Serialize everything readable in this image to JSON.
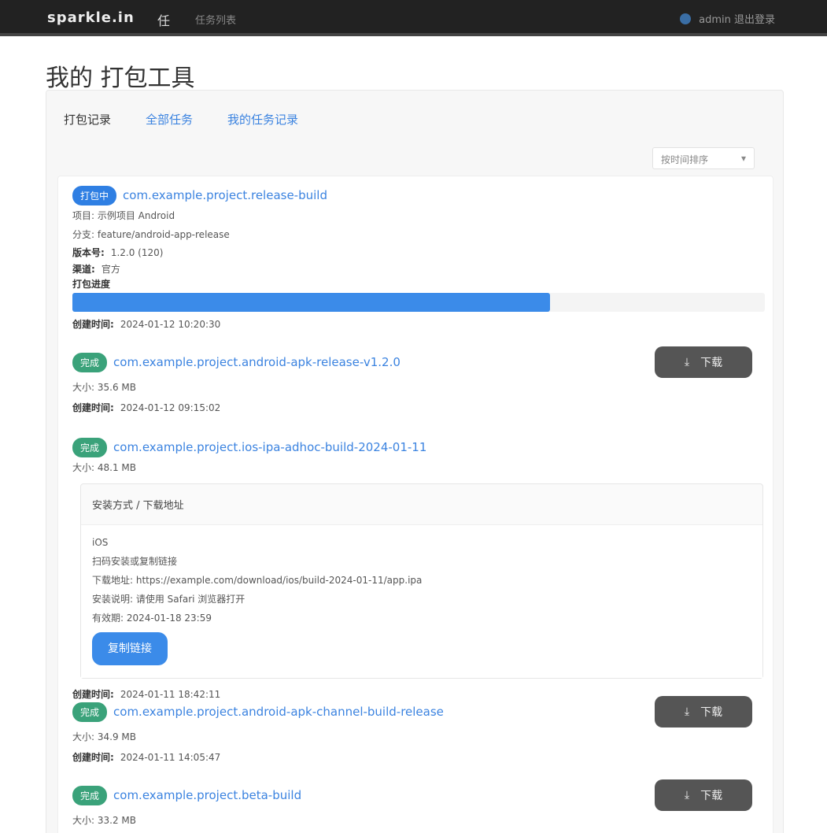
{
  "topbar": {
    "brand": "sparkle.in",
    "nav_cn": "任",
    "nav_link": "任务列表",
    "user_text": "admin 退出登录"
  },
  "page_title": "我的 打包工具",
  "tabs": [
    "打包记录",
    "全部任务",
    "我的任务记录"
  ],
  "sort": {
    "label": "按时间排序",
    "arrow": "▾"
  },
  "tasks": [
    {
      "status": "打包中",
      "title": "com.example.project.release-build",
      "meta": [
        {
          "label": "",
          "value": "项目: 示例项目 Android"
        },
        {
          "label": "",
          "value": "分支: feature/android-app-release"
        },
        {
          "label": "版本号:",
          "value": "1.2.0 (120)"
        },
        {
          "label": "渠道:",
          "value": "官方"
        },
        {
          "label": "打包进度",
          "value": ""
        }
      ],
      "progress": 0.69,
      "created": {
        "label": "创建时间:",
        "value": "2024-01-12 10:20:30"
      }
    },
    {
      "status": "完成",
      "title": "com.example.project.android-apk-release-v1.2.0",
      "download": "下载",
      "meta": [
        {
          "label": "",
          "value": "大小: 35.6 MB"
        }
      ],
      "created": {
        "label": "创建时间:",
        "value": "2024-01-12 09:15:02"
      }
    },
    {
      "status": "完成",
      "title": "com.example.project.ios-ipa-adhoc-build-2024-01-11",
      "meta": [
        {
          "label": "",
          "value": "大小: 48.1 MB"
        }
      ],
      "details": {
        "header": "安装方式 / 下载地址",
        "lines": [
          "iOS",
          "扫码安装或复制链接",
          "下载地址: https://example.com/download/ios/build-2024-01-11/app.ipa",
          "安装说明: 请使用 Safari 浏览器打开",
          "有效期: 2024-01-18 23:59"
        ],
        "button": "复制链接"
      },
      "created": {
        "label": "创建时间:",
        "value": "2024-01-11 18:42:11"
      }
    },
    {
      "status": "完成",
      "title": "com.example.project.android-apk-channel-build-release",
      "download": "下载",
      "meta": [
        {
          "label": "",
          "value": "大小: 34.9 MB"
        }
      ],
      "created": {
        "label": "创建时间:",
        "value": "2024-01-11 14:05:47"
      }
    },
    {
      "status": "完成",
      "title": "com.example.project.beta-build",
      "download": "下载",
      "meta": [
        {
          "label": "",
          "value": "大小: 33.2 MB"
        }
      ]
    }
  ]
}
